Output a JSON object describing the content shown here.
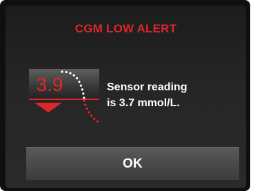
{
  "alert": {
    "title": "CGM LOW ALERT"
  },
  "sensor": {
    "value": "3.9",
    "trend_icon": "down-arrow-icon",
    "message_line1": "Sensor reading",
    "message_line2": "is 3.7 mmol/L."
  },
  "actions": {
    "ok_label": "OK"
  },
  "colors": {
    "alert_red": "#e0262b",
    "background": "#262626",
    "text": "#ffffff"
  }
}
